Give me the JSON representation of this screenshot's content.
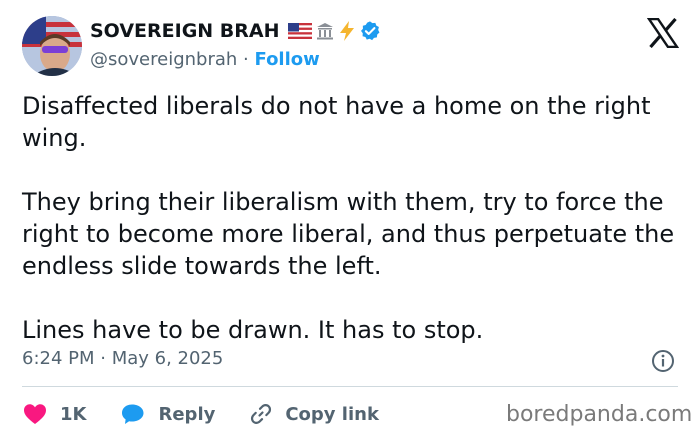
{
  "user": {
    "display_name": "SOVEREIGN BRAH",
    "badges": [
      "🇺🇸",
      "🏛",
      "⚡"
    ],
    "verified": true,
    "handle": "@sovereignbrah",
    "separator": "·",
    "follow_label": "Follow"
  },
  "tweet": {
    "paragraphs": [
      "Disaffected liberals do not have a home on the right wing.",
      "They bring their liberalism with them, try to force the right to become more liberal, and thus perpetuate the endless slide towards the left.",
      "Lines have to be drawn. It has to stop."
    ],
    "timestamp": "6:24 PM · May 6, 2025"
  },
  "actions": {
    "like_count": "1K",
    "reply_label": "Reply",
    "copy_link_label": "Copy link"
  },
  "watermark": "boredpanda.com",
  "colors": {
    "text": "#0f1419",
    "secondary": "#536471",
    "accent": "#1d9bf0",
    "like": "#f91880",
    "divider": "#cfd9de"
  },
  "icons": {
    "x_logo": "x-logo-icon",
    "verified": "verified-badge-icon",
    "info": "info-icon",
    "like": "heart-icon",
    "reply": "speech-bubble-icon",
    "copy_link": "link-icon"
  }
}
